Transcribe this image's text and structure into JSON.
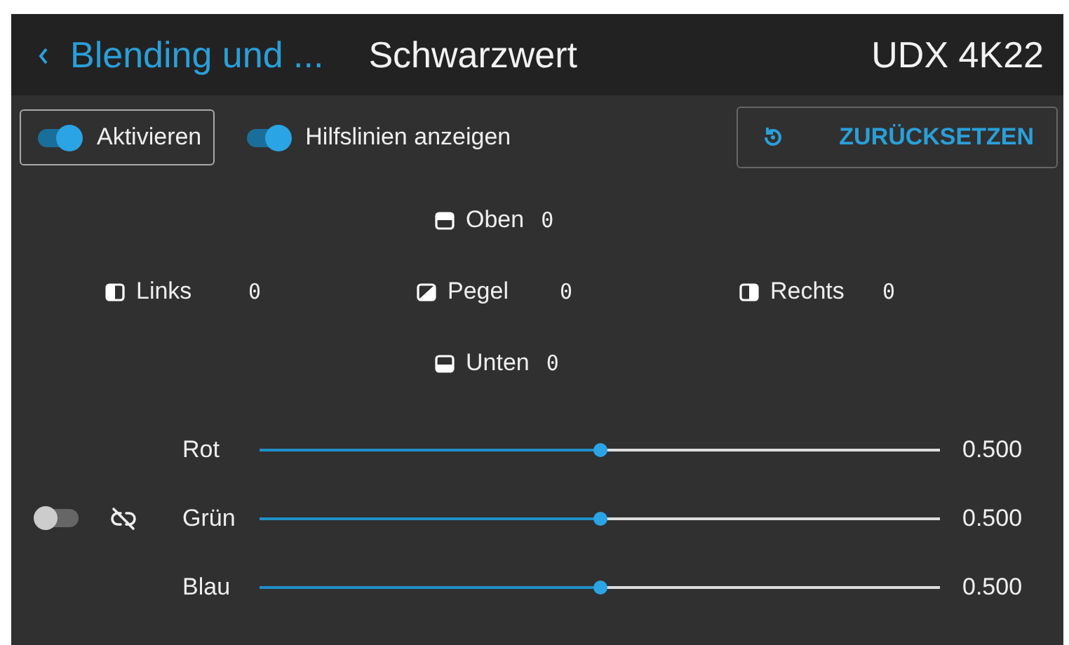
{
  "header": {
    "back_label": "Blending und ...",
    "title": "Schwarzwert",
    "device": "UDX 4K22"
  },
  "toolbar": {
    "enable": {
      "label": "Aktivieren",
      "on": true,
      "focused": true
    },
    "guides": {
      "label": "Hilfslinien anzeigen",
      "on": true
    },
    "reset_button": "ZURÜCKSETZEN"
  },
  "edges": [
    {
      "kind": "top",
      "label": "Oben",
      "value": "0"
    },
    {
      "kind": "left",
      "label": "Links",
      "value": "0"
    },
    {
      "kind": "level",
      "label": "Pegel",
      "value": "0"
    },
    {
      "kind": "right",
      "label": "Rechts",
      "value": "0"
    },
    {
      "kind": "bottom",
      "label": "Unten",
      "value": "0"
    }
  ],
  "link": {
    "on": false,
    "linked": false
  },
  "channels": [
    {
      "label": "Rot",
      "level": 0.5,
      "reading": "0.500"
    },
    {
      "label": "Grün",
      "level": 0.5,
      "reading": "0.500"
    },
    {
      "label": "Blau",
      "level": 0.5,
      "reading": "0.500"
    }
  ]
}
